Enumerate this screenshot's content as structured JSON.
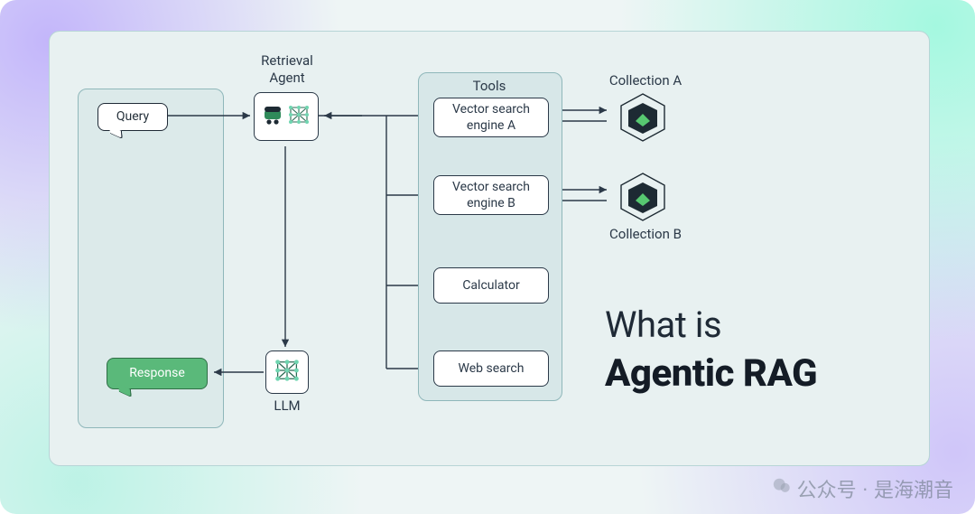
{
  "title": {
    "line1": "What is",
    "line2": "Agentic RAG"
  },
  "labels": {
    "retrieval_agent": "Retrieval\nAgent",
    "llm": "LLM",
    "tools_header": "Tools",
    "collection_a": "Collection A",
    "collection_b": "Collection B"
  },
  "bubbles": {
    "query": "Query",
    "response": "Response"
  },
  "tools": {
    "vector_a": "Vector search\nengine A",
    "vector_b": "Vector search\nengine B",
    "calculator": "Calculator",
    "web_search": "Web search"
  },
  "watermark": {
    "label": "公众号",
    "dot": "·",
    "name": "是海潮音"
  }
}
